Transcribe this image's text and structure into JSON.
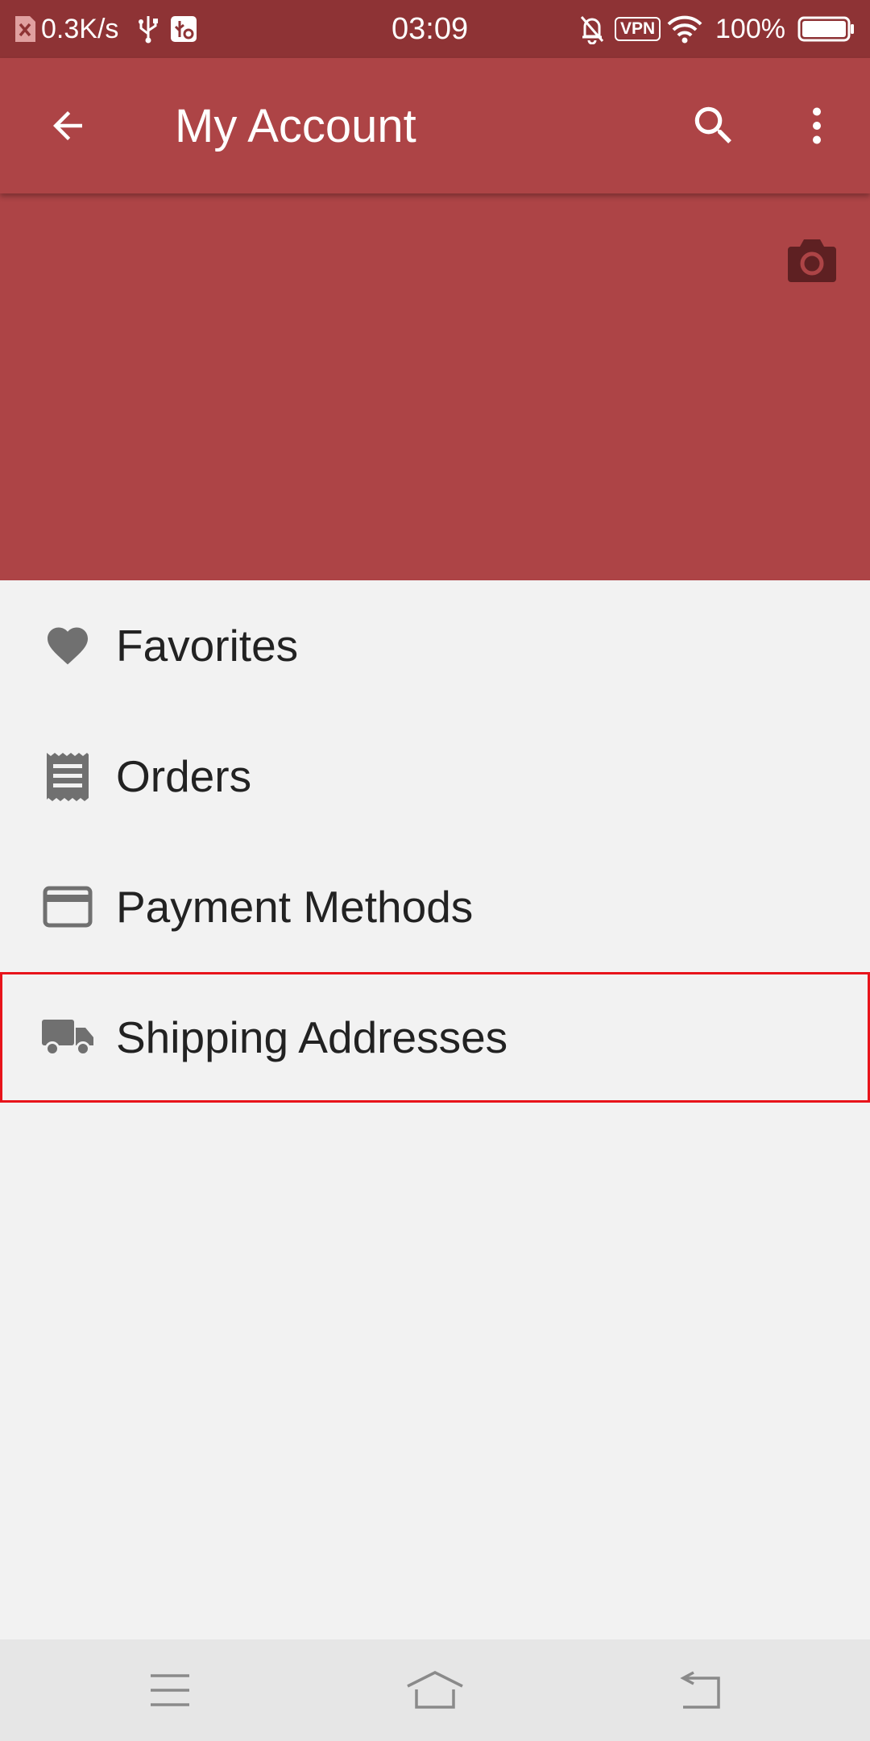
{
  "status_bar": {
    "net_speed": "0.3K/s",
    "time": "03:09",
    "vpn_label": "VPN",
    "battery": "100%",
    "icons": [
      "sim-error-icon",
      "usb-icon",
      "usb-debug-icon",
      "bell-off-icon",
      "vpn-icon",
      "wifi-icon",
      "battery-icon"
    ]
  },
  "app_bar": {
    "title": "My Account",
    "icons": [
      "back-arrow-icon",
      "search-icon",
      "more-vert-icon"
    ]
  },
  "header": {
    "icon": "camera-icon"
  },
  "menu": {
    "items": [
      {
        "label": "Favorites",
        "icon": "heart-icon"
      },
      {
        "label": "Orders",
        "icon": "receipt-icon"
      },
      {
        "label": "Payment Methods",
        "icon": "credit-card-icon"
      },
      {
        "label": "Shipping Addresses",
        "icon": "truck-icon"
      }
    ]
  },
  "nav_bar": {
    "icons": [
      "menu-icon",
      "home-icon",
      "back-icon"
    ]
  },
  "colors": {
    "status_bar": "#8e3335",
    "primary": "#ad4446",
    "background": "#f2f2f2",
    "icon_gray": "#707070",
    "text": "#222222",
    "highlight_border": "#e8141b",
    "nav_bar": "#e6e6e6"
  }
}
